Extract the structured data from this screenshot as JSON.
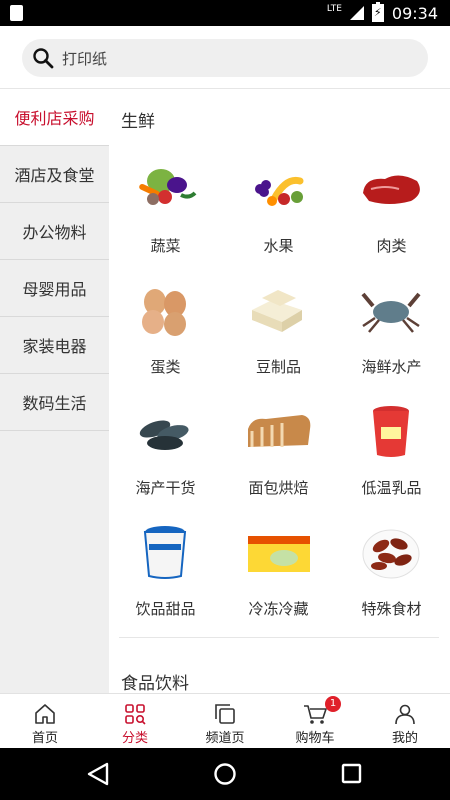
{
  "status_bar": {
    "network": "LTE",
    "time": "09:34"
  },
  "search": {
    "placeholder": "打印纸"
  },
  "sidebar": {
    "items": [
      {
        "label": "便利店采购",
        "active": true
      },
      {
        "label": "酒店及食堂",
        "active": false
      },
      {
        "label": "办公物料",
        "active": false
      },
      {
        "label": "母婴用品",
        "active": false
      },
      {
        "label": "家装电器",
        "active": false
      },
      {
        "label": "数码生活",
        "active": false
      }
    ]
  },
  "content": {
    "sections": [
      {
        "title": "生鲜",
        "items": [
          {
            "label": "蔬菜",
            "icon": "vegetables-image"
          },
          {
            "label": "水果",
            "icon": "fruits-image"
          },
          {
            "label": "肉类",
            "icon": "meat-image"
          },
          {
            "label": "蛋类",
            "icon": "eggs-image"
          },
          {
            "label": "豆制品",
            "icon": "tofu-image"
          },
          {
            "label": "海鲜水产",
            "icon": "crab-image"
          },
          {
            "label": "海产干货",
            "icon": "sea-cucumber-image"
          },
          {
            "label": "面包烘焙",
            "icon": "bread-image"
          },
          {
            "label": "低温乳品",
            "icon": "yogurt-cup-image"
          },
          {
            "label": "饮品甜品",
            "icon": "ice-cream-tub-image"
          },
          {
            "label": "冷冻冷藏",
            "icon": "frozen-package-image"
          },
          {
            "label": "特殊食材",
            "icon": "sausages-image"
          }
        ]
      },
      {
        "title": "食品饮料"
      }
    ]
  },
  "tabbar": {
    "tabs": [
      {
        "label": "首页",
        "icon": "home-icon"
      },
      {
        "label": "分类",
        "icon": "category-icon",
        "active": true
      },
      {
        "label": "频道页",
        "icon": "channel-icon"
      },
      {
        "label": "购物车",
        "icon": "cart-icon",
        "badge": "1"
      },
      {
        "label": "我的",
        "icon": "profile-icon"
      }
    ]
  },
  "colors": {
    "accent": "#c8102e",
    "badge": "#e0202a",
    "sidebar_bg": "#efefef"
  }
}
